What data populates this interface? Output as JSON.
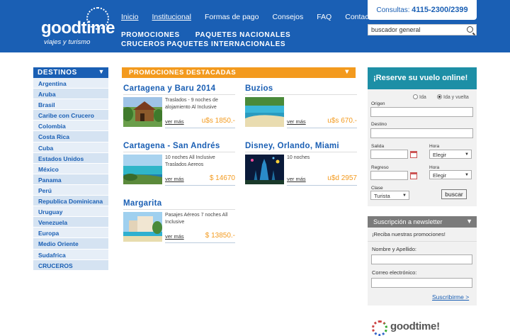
{
  "header": {
    "logo_main": "goodtime",
    "logo_sub": "viajes y turismo",
    "topnav": [
      "Inicio",
      "Institucional",
      "Formas de pago",
      "Consejos",
      "FAQ",
      "Contacto"
    ],
    "mainnav": [
      "PROMOCIONES",
      "PAQUETES NACIONALES",
      "CRUCEROS",
      "PAQUETES INTERNACIONALES"
    ],
    "phone_label": "Consultas:",
    "phone_number": "4115-2300/2399",
    "search_value": "buscador general"
  },
  "destinos": {
    "title": "DESTINOS",
    "items": [
      "Argentina",
      "Aruba",
      "Brasil",
      "Caribe con Crucero",
      "Colombia",
      "Costa Rica",
      "Cuba",
      "Estados Unidos",
      "México",
      "Panama",
      "Perú",
      "Republica Dominicana",
      "Uruguay",
      "Venezuela",
      "Europa",
      "Medio Oriente",
      "Sudafrica",
      "CRUCEROS"
    ]
  },
  "promos": {
    "title": "PROMOCIONES DESTACADAS",
    "more_label": "ver más",
    "cards": [
      {
        "title": "Cartagena y Baru 2014",
        "desc": "Traslados - 9 noches de alojamiento Al Inclusive",
        "price": "u$s 1850.-"
      },
      {
        "title": "Buzios",
        "desc": "",
        "price": "u$s 670.-"
      },
      {
        "title": "Cartagena - San Andrés",
        "desc": "10 noches All Inclusive Traslados Aereos",
        "price": "$ 14670"
      },
      {
        "title": "Disney, Orlando, Miami",
        "desc": "10 noches",
        "price": "u$d 2957"
      },
      {
        "title": "Margarita",
        "desc": "Pasajes Aéreos 7 noches All Inclusive",
        "price": "$ 13850.-"
      }
    ]
  },
  "reserve": {
    "title": "¡Reserve su vuelo online!",
    "radio_ida": "Ida",
    "radio_idavuelta": "Ida y vuelta",
    "origen": "Origen",
    "destino": "Destino",
    "salida": "Salida",
    "regreso": "Regreso",
    "hora": "Hora",
    "hora_value": "Elegir",
    "clase": "Clase",
    "clase_value": "Turista",
    "search_button": "buscar"
  },
  "newsletter": {
    "title": "Suscripción a newsletter",
    "subtitle": "¡Reciba nuestras promociones!",
    "name_label": "Nombre y Apellido:",
    "email_label": "Correo electrónico:",
    "submit": "Suscribirme >"
  },
  "footer_logo": "goodtime!"
}
